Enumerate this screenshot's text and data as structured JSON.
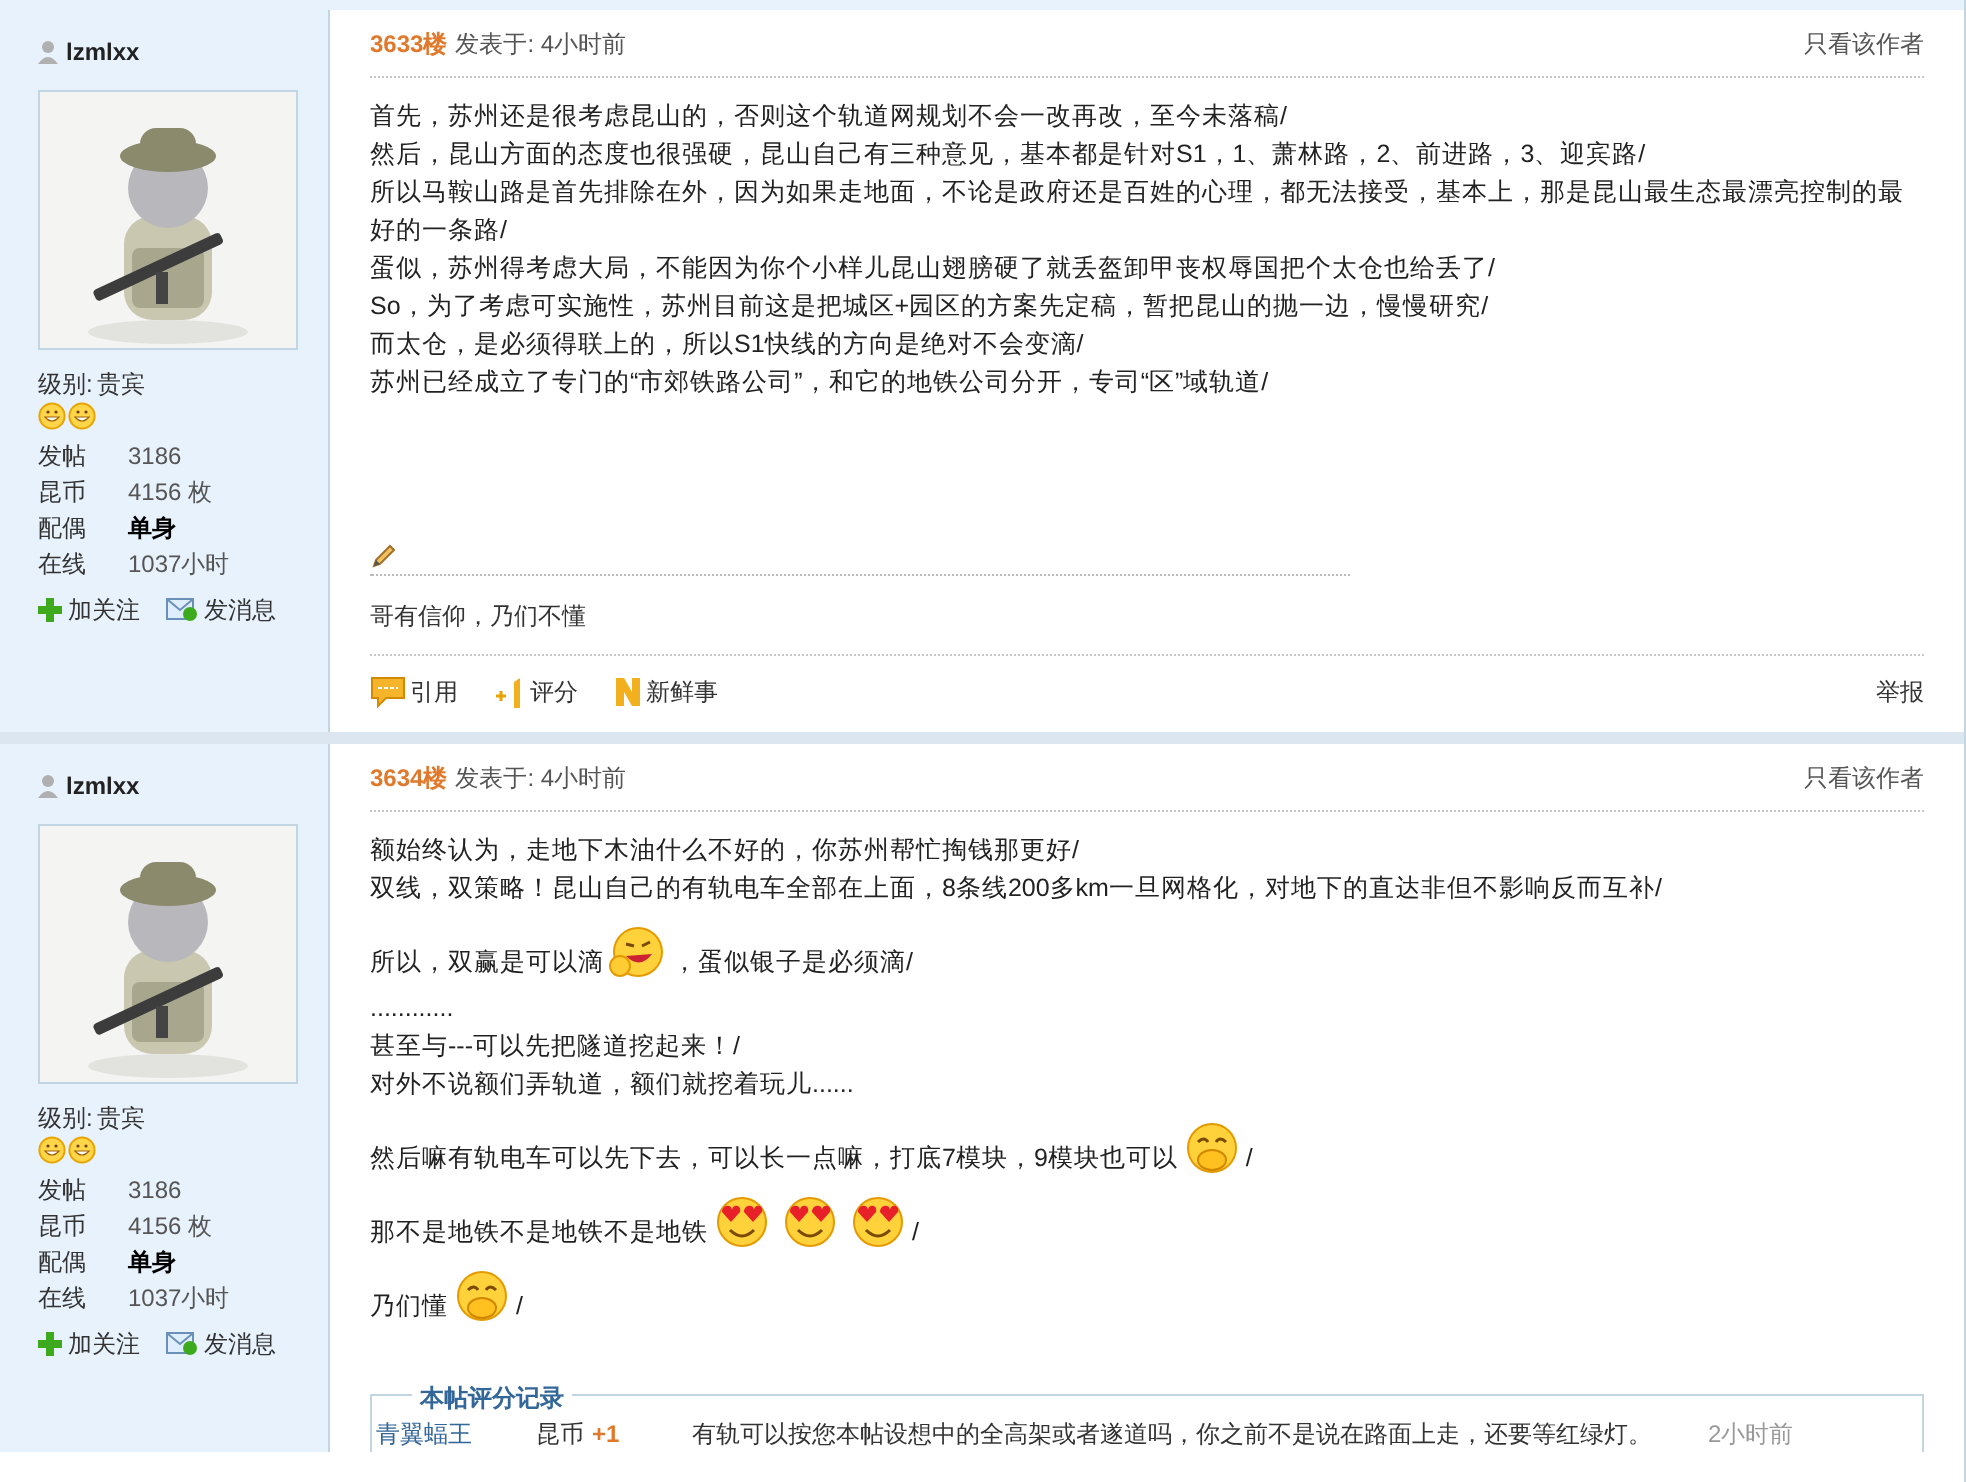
{
  "posts": [
    {
      "author": {
        "name": "lzmlxx",
        "level_label": "级别:",
        "level": "贵宾",
        "stats": [
          {
            "label": "发帖",
            "value": "3186",
            "kind": "plain"
          },
          {
            "label": "昆币",
            "value": "4156 枚",
            "kind": "plain"
          },
          {
            "label": "配偶",
            "value": "单身",
            "kind": "bold"
          },
          {
            "label": "在线",
            "value": "1037小时",
            "kind": "plain"
          }
        ],
        "actions": [
          {
            "label": "加关注",
            "kind": "follow"
          },
          {
            "label": "发消息",
            "kind": "message"
          }
        ]
      },
      "floor": "3633楼",
      "posted": "发表于: 4小时前",
      "author_only": "只看该作者",
      "lines": [
        {
          "parts": [
            {
              "kind": "text",
              "text": "首先，苏州还是很考虑昆山的，否则这个轨道网规划不会一改再改，至今未落稿/"
            }
          ]
        },
        {
          "parts": [
            {
              "kind": "text",
              "text": "然后，昆山方面的态度也很强硬，昆山自己有三种意见，基本都是针对S1，1、萧林路，2、前进路，3、迎宾路/"
            }
          ]
        },
        {
          "parts": [
            {
              "kind": "text",
              "text": "所以马鞍山路是首先排除在外，因为如果走地面，不论是政府还是百姓的心理，都无法接受，基本上，那是昆山最生态最漂亮控制的最好的一条路/"
            }
          ]
        },
        {
          "parts": [
            {
              "kind": "text",
              "text": "蛋似，苏州得考虑大局，不能因为你个小样儿昆山翅膀硬了就丢盔卸甲丧权辱国把个太仓也给丢了/"
            }
          ]
        },
        {
          "parts": [
            {
              "kind": "text",
              "text": "So，为了考虑可实施性，苏州目前这是把城区+园区的方案先定稿，暂把昆山的抛一边，慢慢研究/"
            }
          ]
        },
        {
          "parts": [
            {
              "kind": "text",
              "text": "而太仓，是必须得联上的，所以S1快线的方向是绝对不会变滴/"
            }
          ]
        },
        {
          "parts": [
            {
              "kind": "text",
              "text": "苏州已经成立了专门的“市郊铁路公司”，和它的地铁公司分开，专司“区”域轨道/"
            }
          ]
        }
      ],
      "signature": "哥有信仰，乃们不懂",
      "footer": {
        "actions": [
          {
            "label": "引用",
            "kind": "quote"
          },
          {
            "label": "评分",
            "kind": "rate"
          },
          {
            "label": "新鲜事",
            "kind": "news"
          }
        ],
        "report": "举报"
      }
    },
    {
      "author": {
        "name": "lzmlxx",
        "level_label": "级别:",
        "level": "贵宾",
        "stats": [
          {
            "label": "发帖",
            "value": "3186",
            "kind": "plain"
          },
          {
            "label": "昆币",
            "value": "4156 枚",
            "kind": "plain"
          },
          {
            "label": "配偶",
            "value": "单身",
            "kind": "bold"
          },
          {
            "label": "在线",
            "value": "1037小时",
            "kind": "plain"
          }
        ],
        "actions": [
          {
            "label": "加关注",
            "kind": "follow"
          },
          {
            "label": "发消息",
            "kind": "message"
          }
        ]
      },
      "floor": "3634楼",
      "posted": "发表于: 4小时前",
      "author_only": "只看该作者",
      "lines": [
        {
          "parts": [
            {
              "kind": "text",
              "text": "额始终认为，走地下木油什么不好的，你苏州帮忙掏钱那更好/"
            }
          ]
        },
        {
          "parts": [
            {
              "kind": "text",
              "text": "双线，双策略！昆山自己的有轨电车全部在上面，8条线200多km一旦网格化，对地下的直达非但不影响反而互补/"
            }
          ]
        },
        {
          "parts": [
            {
              "kind": "text",
              "text": "所以，双赢是可以滴"
            },
            {
              "kind": "thumbs-smiley"
            },
            {
              "kind": "text",
              "text": "，蛋似银子是必须滴/"
            }
          ]
        },
        {
          "parts": [
            {
              "kind": "text",
              "text": "............"
            }
          ]
        },
        {
          "parts": [
            {
              "kind": "text",
              "text": "甚至与---可以先把隧道挖起来！/"
            }
          ]
        },
        {
          "parts": [
            {
              "kind": "text",
              "text": "对外不说额们弄轨道，额们就挖着玩儿......"
            }
          ]
        },
        {
          "parts": [
            {
              "kind": "text",
              "text": "然后嘛有轨电车可以先下去，可以长一点嘛，打底7模块，9模块也可以"
            },
            {
              "kind": "laughing-smiley"
            },
            {
              "kind": "text",
              "text": "/"
            }
          ]
        },
        {
          "parts": [
            {
              "kind": "text",
              "text": "那不是地铁不是地铁不是地铁"
            },
            {
              "kind": "heart-eyes-smiley"
            },
            {
              "kind": "heart-eyes-smiley"
            },
            {
              "kind": "heart-eyes-smiley"
            },
            {
              "kind": "text",
              "text": "/"
            }
          ]
        },
        {
          "parts": [
            {
              "kind": "text",
              "text": "乃们懂"
            },
            {
              "kind": "laughing-smiley"
            },
            {
              "kind": "text",
              "text": "/"
            }
          ]
        }
      ],
      "ratings": {
        "legend": "本帖评分记录",
        "rows": [
          {
            "user": "青翼蝠王",
            "currency": "昆币",
            "amount": "+1",
            "reason": "有轨可以按您本帖设想中的全高架或者遂道吗，你之前不是说在路面上走，还要等红绿灯。",
            "time": "2小时前"
          }
        ]
      }
    }
  ]
}
